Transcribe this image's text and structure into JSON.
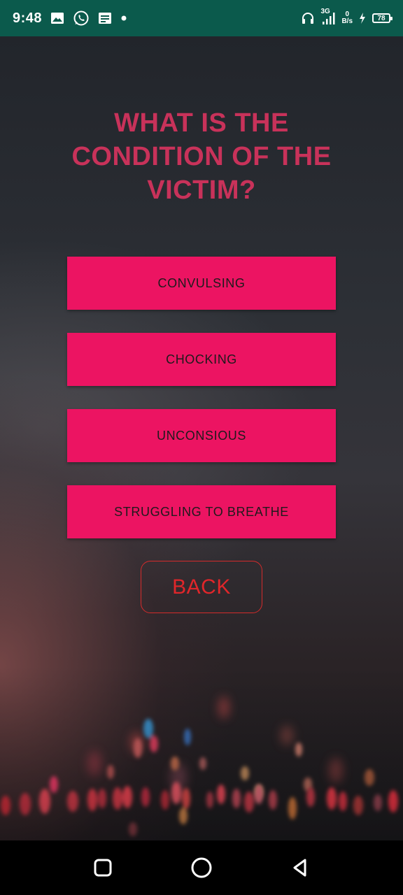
{
  "status_bar": {
    "time": "9:48",
    "network_label": "3G",
    "speed_value": "0",
    "speed_unit": "B/s",
    "battery_level": "78",
    "icons": [
      "gallery-icon",
      "whatsapp-icon",
      "message-icon",
      "dot-icon",
      "headphones-icon",
      "signal-icon",
      "charging-icon",
      "battery-icon"
    ]
  },
  "screen": {
    "question": "WHAT IS THE CONDITION OF THE VICTIM?",
    "options": [
      {
        "label": "CONVULSING"
      },
      {
        "label": "CHOCKING"
      },
      {
        "label": "UNCONSIOUS"
      },
      {
        "label": "STRUGGLING TO BREATHE"
      }
    ],
    "back_label": "BACK"
  },
  "colors": {
    "status_bar": "#0b5a4c",
    "question_text": "#c8325a",
    "option_button": "#ec1462",
    "back_accent": "#e0262a"
  },
  "nav_bar": {
    "icons": [
      "recents-icon",
      "home-icon",
      "back-triangle-icon"
    ]
  }
}
